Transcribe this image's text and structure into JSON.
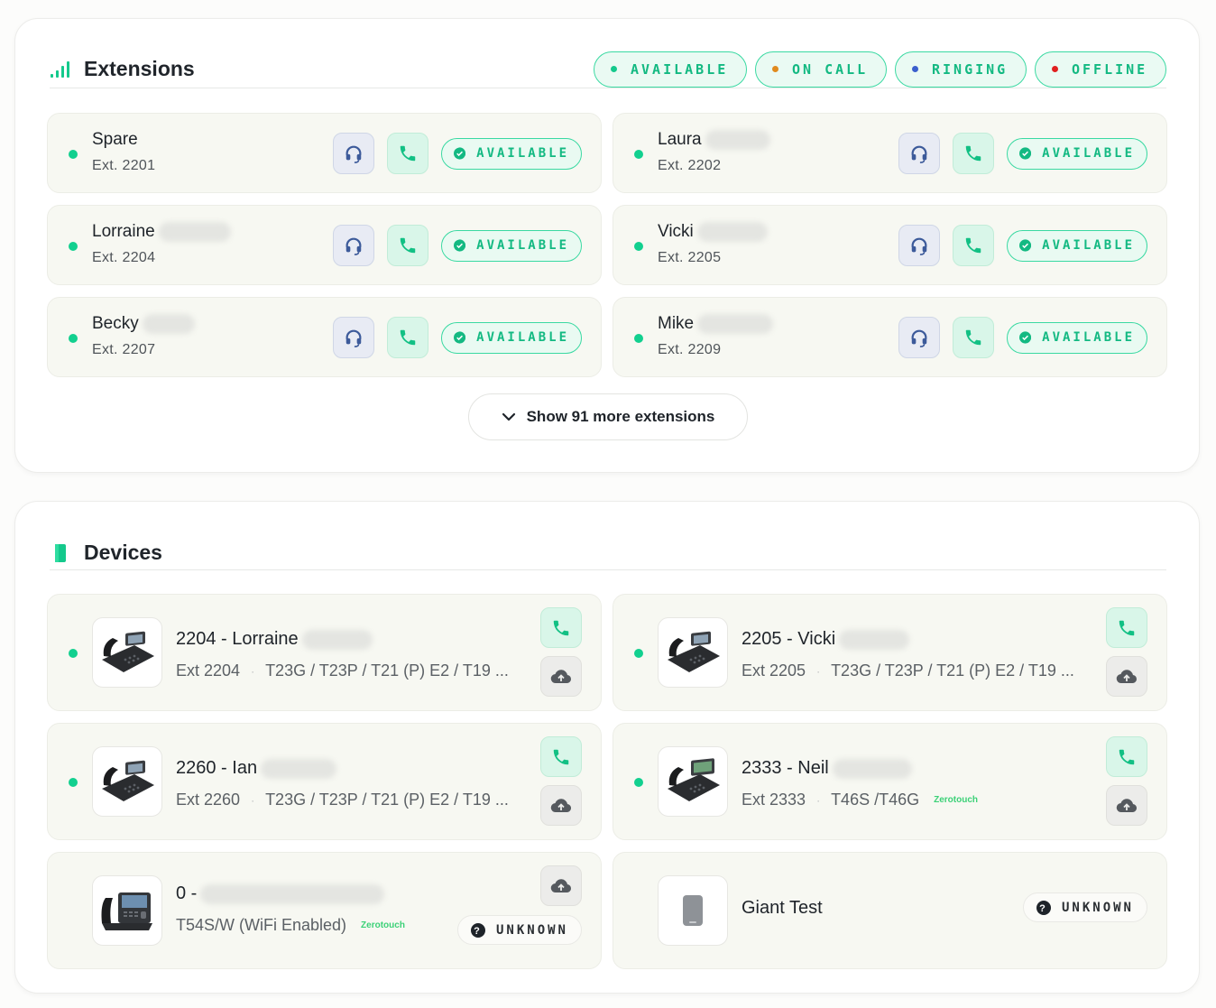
{
  "extensions": {
    "title": "Extensions",
    "legend": [
      {
        "label": "AVAILABLE",
        "color": "#14c98c"
      },
      {
        "label": "ON CALL",
        "color": "#e08a1e"
      },
      {
        "label": "RINGING",
        "color": "#3a5fcd"
      },
      {
        "label": "OFFLINE",
        "color": "#e02020"
      }
    ],
    "items": [
      {
        "name": "Spare",
        "ext": "Ext. 2201",
        "status": "AVAILABLE"
      },
      {
        "name": "Laura",
        "ext": "Ext. 2202",
        "status": "AVAILABLE"
      },
      {
        "name": "Lorraine",
        "ext": "Ext. 2204",
        "status": "AVAILABLE"
      },
      {
        "name": "Vicki",
        "ext": "Ext. 2205",
        "status": "AVAILABLE"
      },
      {
        "name": "Becky",
        "ext": "Ext. 2207",
        "status": "AVAILABLE"
      },
      {
        "name": "Mike",
        "ext": "Ext. 2209",
        "status": "AVAILABLE"
      }
    ],
    "show_more_label": "Show 91 more extensions"
  },
  "devices": {
    "title": "Devices",
    "items": [
      {
        "title": "2204 - Lorraine",
        "ext": "Ext 2204",
        "model": "T23G / T23P / T21 (P) E2 / T19 ...",
        "online": true
      },
      {
        "title": "2205 - Vicki",
        "ext": "Ext 2205",
        "model": "T23G / T23P / T21 (P) E2 / T19 ...",
        "online": true
      },
      {
        "title": "2260 - Ian",
        "ext": "Ext 2260",
        "model": "T23G / T23P / T21 (P) E2 / T19 ...",
        "online": true
      },
      {
        "title": "2333 - Neil",
        "ext": "Ext 2333",
        "model": "T46S /T46G",
        "zerotouch": "Zerotouch",
        "online": true
      },
      {
        "title": "0 -",
        "model": "T54S/W (WiFi Enabled)",
        "zerotouch": "Zerotouch",
        "status": "UNKNOWN",
        "online": false
      },
      {
        "title": "Giant Test",
        "status": "UNKNOWN",
        "online": false
      }
    ]
  }
}
